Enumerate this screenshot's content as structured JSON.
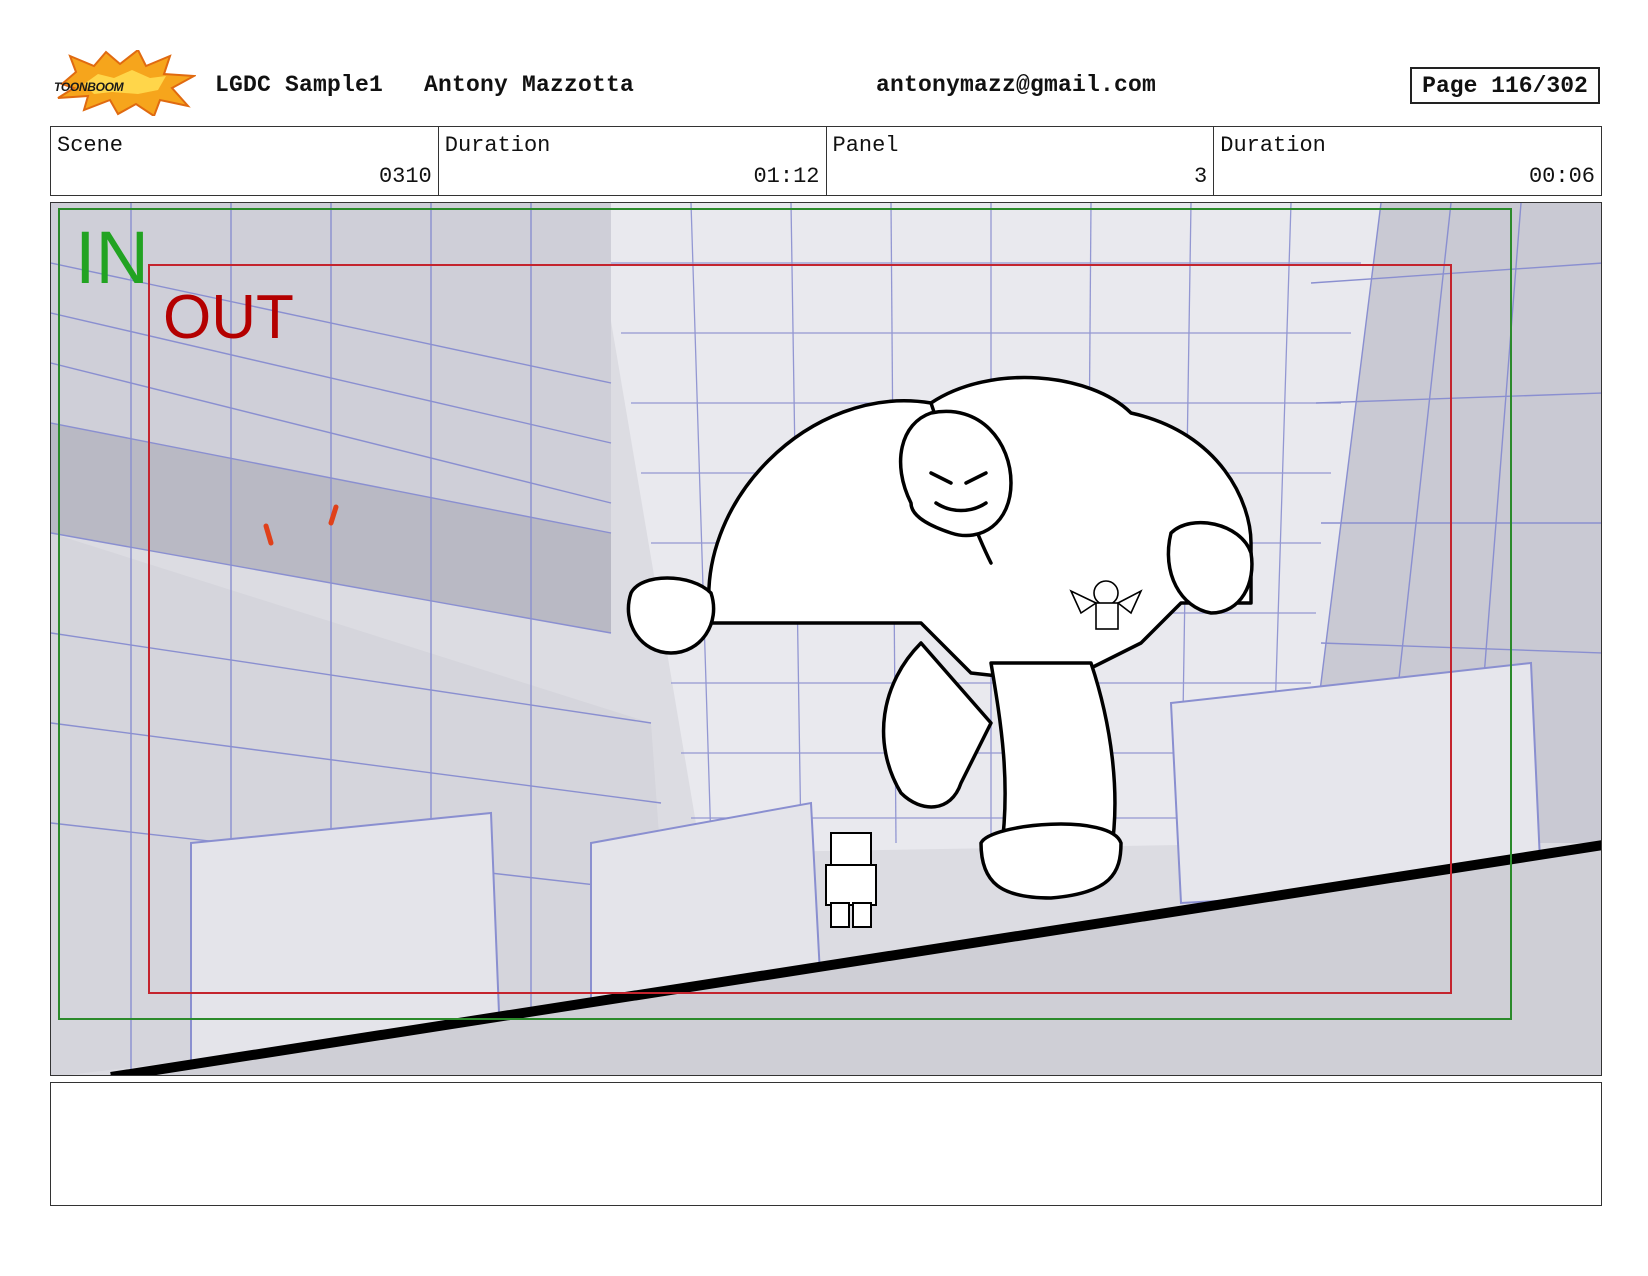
{
  "header": {
    "logo_text": "TOONBOOM",
    "project": "LGDC Sample1",
    "artist": "Antony Mazzotta",
    "email": "antonymazz@gmail.com",
    "page": "Page 116/302"
  },
  "info": {
    "scene_label": "Scene",
    "scene_value": "0310",
    "scene_duration_label": "Duration",
    "scene_duration_value": "01:12",
    "panel_label": "Panel",
    "panel_value": "3",
    "panel_duration_label": "Duration",
    "panel_duration_value": "00:06"
  },
  "panel": {
    "in_label": "IN",
    "out_label": "OUT",
    "in_color": "#22a322",
    "out_color": "#b40000",
    "line_color": "#8a8fd0"
  },
  "notes": {
    "text": ""
  }
}
